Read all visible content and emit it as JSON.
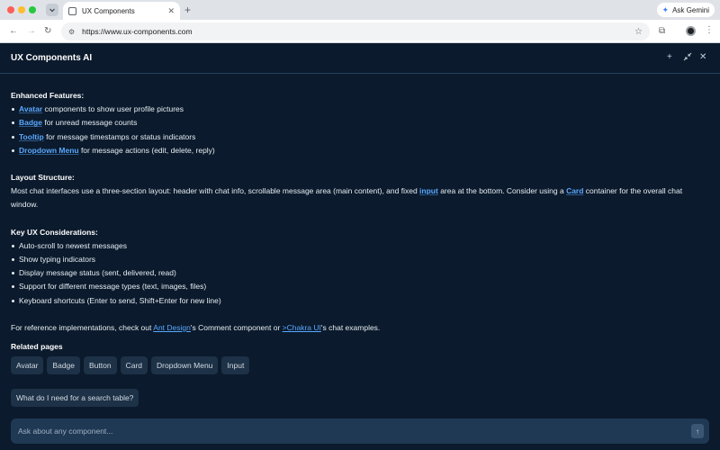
{
  "browser": {
    "tab_title": "UX Components",
    "url": "https://www.ux-components.com",
    "ask_gemini": "Ask Gemini"
  },
  "header": {
    "title": "UX Components AI"
  },
  "enhanced": {
    "heading": "Enhanced Features:",
    "items": [
      {
        "link": "Avatar",
        "text": " components to show user profile pictures"
      },
      {
        "link": "Badge",
        "text": " for unread message counts"
      },
      {
        "link": "Tooltip",
        "text": " for message timestamps or status indicators"
      },
      {
        "link": "Dropdown Menu",
        "text": " for message actions (edit, delete, reply)"
      }
    ]
  },
  "layout": {
    "heading": "Layout Structure:",
    "text_1": "Most chat interfaces use a three-section layout: header with chat info, scrollable message area (main content), and fixed ",
    "link_1": "input",
    "text_2": " area at the bottom. Consider using a ",
    "link_2": "Card",
    "text_3": " container for the overall chat window."
  },
  "key_ux": {
    "heading": "Key UX Considerations:",
    "items": [
      "Auto-scroll to newest messages",
      "Show typing indicators",
      "Display message status (sent, delivered, read)",
      "Support for different message types (text, images, files)",
      "Keyboard shortcuts (Enter to send, Shift+Enter for new line)"
    ]
  },
  "reference": {
    "text_1": "For reference implementations, check out ",
    "link_1": "Ant Design",
    "text_2": "'s Comment component or ",
    "link_2": ">Chakra UI",
    "text_3": "'s chat examples."
  },
  "related": {
    "label": "Related pages",
    "chips": [
      "Avatar",
      "Badge",
      "Button",
      "Card",
      "Dropdown Menu",
      "Input"
    ]
  },
  "suggestion": "What do I need for a search table?",
  "composer": {
    "placeholder": "Ask about any component..."
  },
  "colors": {
    "background": "#0b1a2c",
    "link": "#5aa9ff",
    "chip": "#1d3147",
    "composer": "#1f3955"
  },
  "icons": [
    "tab-menu-icon",
    "favicon-icon",
    "close-icon",
    "plus-icon",
    "gemini-sparkle-icon",
    "back-icon",
    "forward-icon",
    "reload-icon",
    "site-settings-icon",
    "star-icon",
    "extensions-icon",
    "profile-icon",
    "kebab-menu-icon",
    "collapse-icon",
    "send-icon"
  ]
}
